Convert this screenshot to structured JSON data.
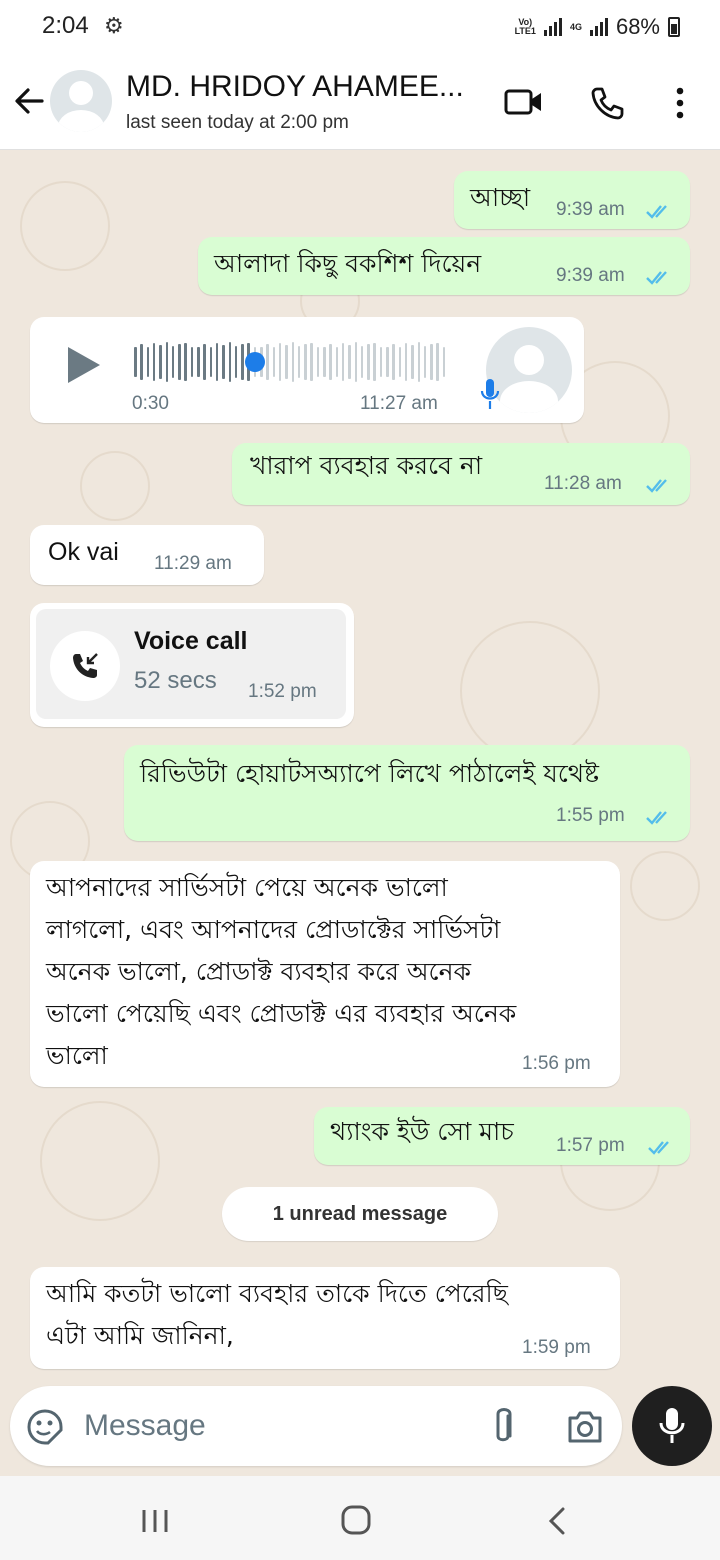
{
  "status_bar": {
    "time": "2:04",
    "network_top": "Vo)",
    "network_bottom": "LTE1",
    "network_type": "4G",
    "battery": "68%"
  },
  "header": {
    "contact_name": "MD. HRIDOY AHAMEE...",
    "last_seen": "last seen today at 2:00 pm",
    "icons": [
      "back-arrow-icon",
      "video-call-icon",
      "phone-icon",
      "more-vertical-icon"
    ]
  },
  "messages": [
    {
      "dir": "out",
      "text": "আচ্ছা",
      "time": "9:39 am",
      "read": true
    },
    {
      "dir": "out",
      "text": "আলাদা কিছু বকশিশ দিয়েন",
      "time": "9:39 am",
      "read": true
    },
    {
      "dir": "in",
      "type": "voice",
      "duration": "0:30",
      "time": "11:27 am",
      "progress": 0.38
    },
    {
      "dir": "out",
      "text": "খারাপ ব্যবহার করবে না",
      "time": "11:28 am",
      "read": true
    },
    {
      "dir": "in",
      "text": "Ok vai",
      "time": "11:29 am"
    },
    {
      "dir": "in",
      "type": "call",
      "title": "Voice call",
      "subtitle": "52 secs",
      "time": "1:52 pm"
    },
    {
      "dir": "out",
      "text": "রিভিউটা হোয়াটসঅ্যাপে লিখে পাঠালেই যথেষ্ট",
      "time": "1:55 pm",
      "read": true
    },
    {
      "dir": "in",
      "lines": [
        "আপনাদের সার্ভিসটা পেয়ে অনেক ভালো",
        "লাগলো, এবং আপনাদের প্রোডাক্টের সার্ভিসটা",
        "অনেক ভালো, প্রোডাক্ট ব্যবহার করে অনেক",
        "ভালো পেয়েছি এবং প্রোডাক্ট এর ব্যবহার অনেক",
        "ভালো"
      ],
      "time": "1:56 pm"
    },
    {
      "dir": "out",
      "text": "থ্যাংক ইউ সো মাচ",
      "time": "1:57 pm",
      "read": true
    },
    {
      "dir": "in",
      "lines": [
        "আমি কতটা ভালো ব্যবহার তাকে দিতে পেরেছি",
        "এটা আমি জানিনা,"
      ],
      "time": "1:59 pm"
    }
  ],
  "unread_banner": "1 unread message",
  "composer": {
    "placeholder": "Message",
    "icons": [
      "emoji-sticker-icon",
      "attach-icon",
      "camera-icon",
      "mic-icon"
    ]
  },
  "colors": {
    "outgoing_bubble": "#d9fdd3",
    "incoming_bubble": "#ffffff",
    "read_ticks": "#53bdeb",
    "voice_progress": "#1d7de8",
    "wallpaper": "#efe7dd"
  }
}
